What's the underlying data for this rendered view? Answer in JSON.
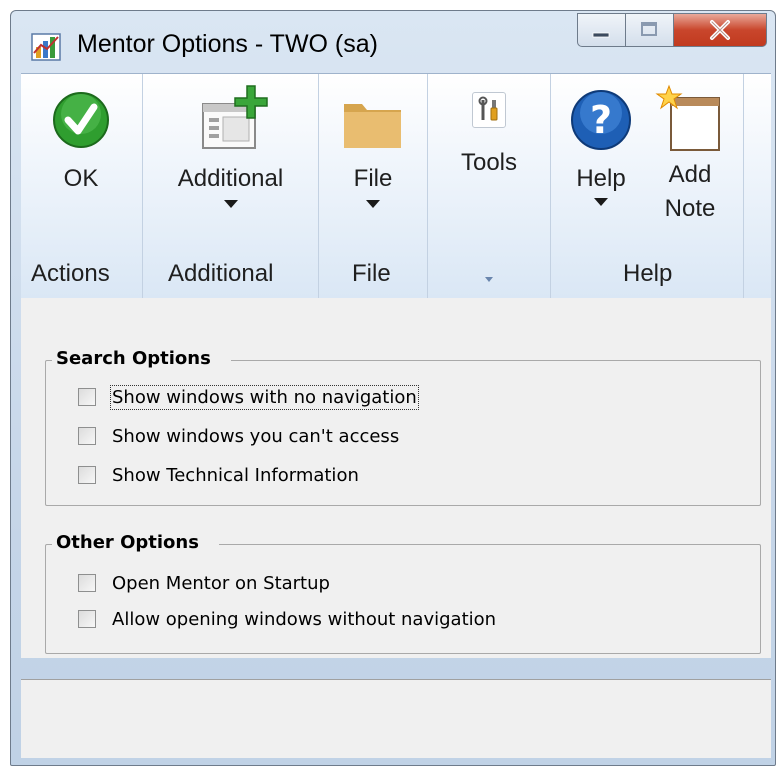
{
  "window": {
    "title": "Mentor Options  -  TWO (sa)"
  },
  "ribbon": {
    "groups": [
      {
        "label": "Actions",
        "buttons": [
          {
            "label": "OK",
            "icon": "ok-check-icon"
          }
        ]
      },
      {
        "label": "Additional",
        "buttons": [
          {
            "label": "Additional",
            "icon": "additional-window-add-icon",
            "dropdown": true
          }
        ]
      },
      {
        "label": "File",
        "buttons": [
          {
            "label": "File",
            "icon": "folder-icon",
            "dropdown": true
          }
        ]
      },
      {
        "label": "",
        "buttons": [
          {
            "label": "Tools",
            "icon": "tools-icon"
          }
        ]
      },
      {
        "label": "Help",
        "buttons": [
          {
            "label": "Help",
            "icon": "help-question-icon",
            "dropdown": true
          },
          {
            "label_line1": "Add",
            "label_line2": "Note",
            "icon": "add-note-icon"
          }
        ]
      }
    ]
  },
  "search_options": {
    "legend": "Search Options",
    "items": [
      {
        "label": "Show windows with no navigation",
        "checked": false,
        "focused": true
      },
      {
        "label": "Show windows you can't access",
        "checked": false
      },
      {
        "label": "Show Technical Information",
        "checked": false
      }
    ]
  },
  "other_options": {
    "legend": "Other Options",
    "items": [
      {
        "label": "Open Mentor on Startup",
        "checked": false
      },
      {
        "label": "Allow opening windows without navigation",
        "checked": false
      }
    ]
  },
  "colors": {
    "ok_green": "#2f9e2f",
    "help_blue": "#1e5fb5",
    "close_red": "#c9462c",
    "folder": "#e5b869"
  }
}
